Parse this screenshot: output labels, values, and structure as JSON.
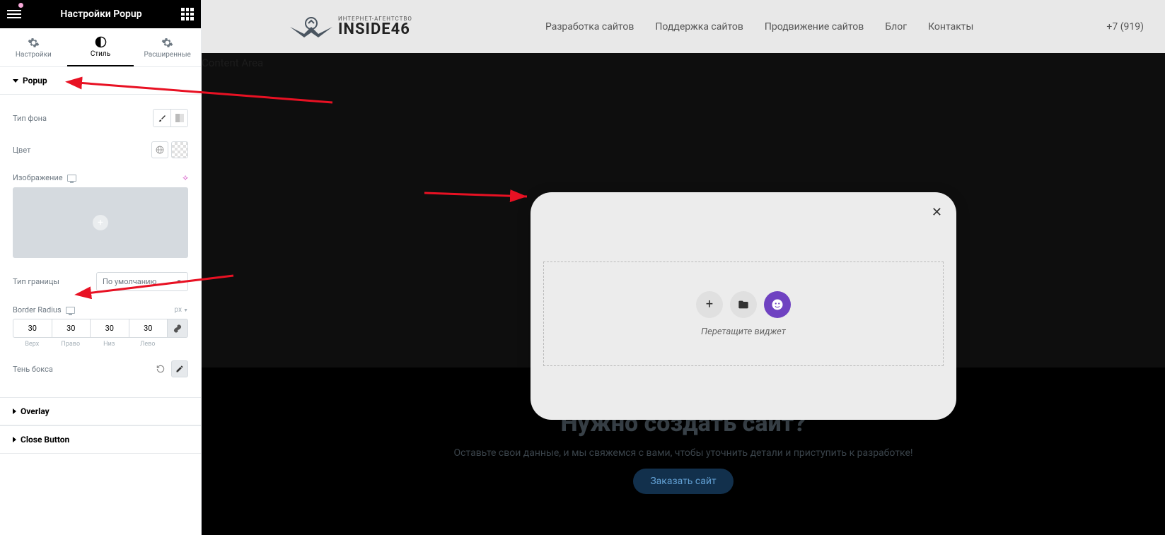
{
  "header": {
    "title": "Настройки Popup"
  },
  "tabs": {
    "settings": "Настройки",
    "style": "Стиль",
    "advanced": "Расширенные"
  },
  "section": {
    "popup": "Popup",
    "overlay": "Overlay",
    "close_button": "Close Button"
  },
  "controls": {
    "bg_type": "Тип фона",
    "color": "Цвет",
    "image": "Изображение",
    "border_type": "Тип границы",
    "border_type_value": "По умолчанию",
    "border_radius": "Border Radius",
    "unit": "px",
    "radius": {
      "top": "30",
      "right": "30",
      "bottom": "30",
      "left": "30"
    },
    "dim_labels": {
      "top": "Верх",
      "right": "Право",
      "bottom": "Низ",
      "left": "Лево"
    },
    "box_shadow": "Тень бокса"
  },
  "site": {
    "content_area": "Content Area",
    "logo_sub": "ИНТЕРНЕТ-АГЕНТСТВО",
    "logo_main": "INSIDE46",
    "nav": {
      "dev": "Разработка сайтов",
      "support": "Поддержка сайтов",
      "promo": "Продвижение сайтов",
      "blog": "Блог",
      "contacts": "Контакты"
    },
    "phone": "+7 (919)"
  },
  "footer": {
    "title": "Нужно создать сайт?",
    "sub": "Оставьте свои данные, и мы свяжемся с вами, чтобы уточнить детали и приступить к разработке!",
    "btn": "Заказать сайт"
  },
  "popup": {
    "drag": "Перетащите виджет"
  }
}
